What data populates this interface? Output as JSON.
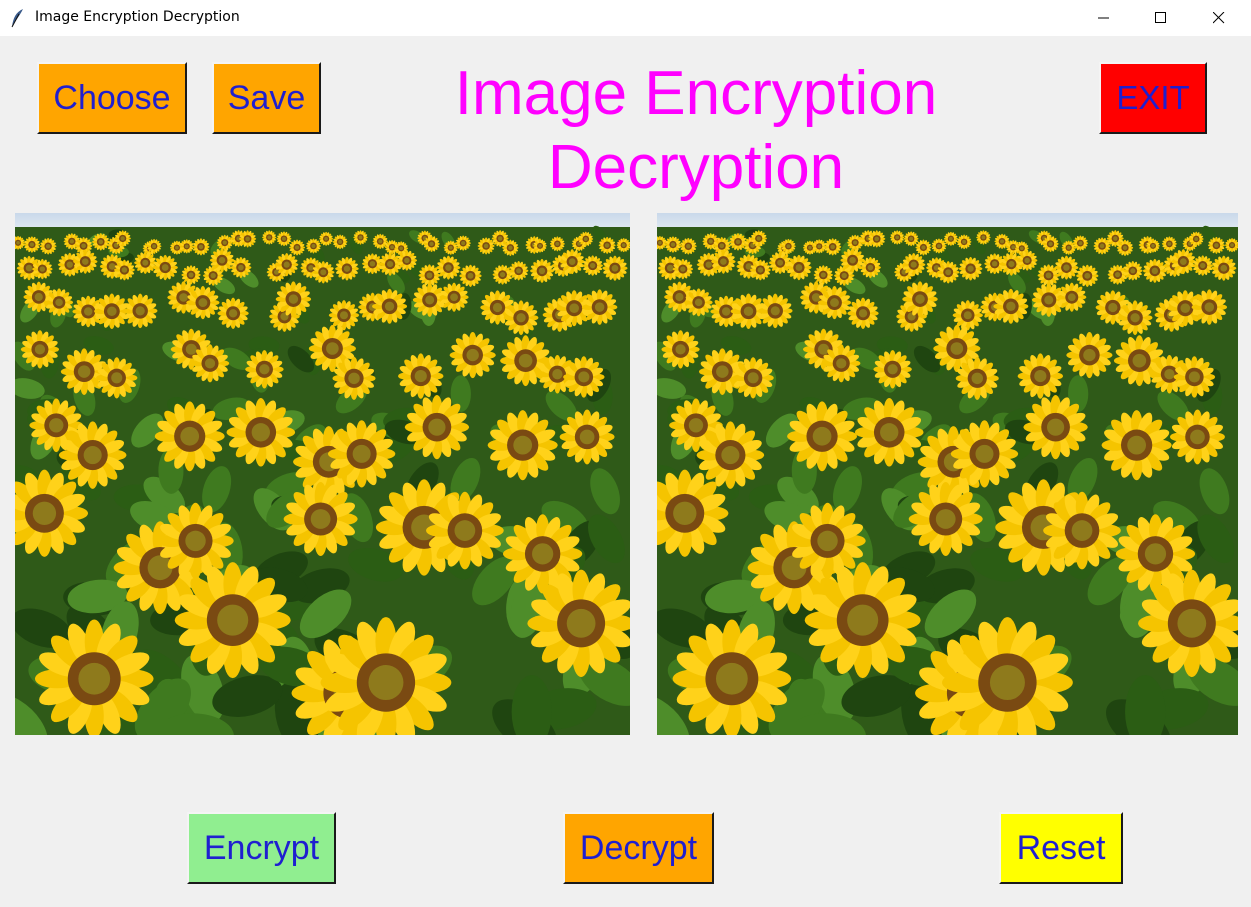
{
  "window": {
    "title": "Image Encryption Decryption",
    "app_icon": "feather-icon",
    "controls": [
      "minimize-icon",
      "maximize-icon",
      "close-icon"
    ]
  },
  "toolbar": {
    "choose_label": "Choose",
    "save_label": "Save",
    "exit_label": "EXIT"
  },
  "heading": {
    "line1": "Image Encryption",
    "line2": "Decryption"
  },
  "images": {
    "original": "sunflower field photo",
    "processed": "sunflower field photo"
  },
  "actions": {
    "encrypt_label": "Encrypt",
    "decrypt_label": "Decrypt",
    "reset_label": "Reset"
  },
  "colors": {
    "background": "#f0f0f0",
    "heading": "#ff00ff",
    "button_text": "#1f1fd0",
    "choose_bg": "#ffa500",
    "save_bg": "#ffa500",
    "exit_bg": "#ff0000",
    "encrypt_bg": "#90ee90",
    "decrypt_bg": "#ffa500",
    "reset_bg": "#ffff00"
  }
}
